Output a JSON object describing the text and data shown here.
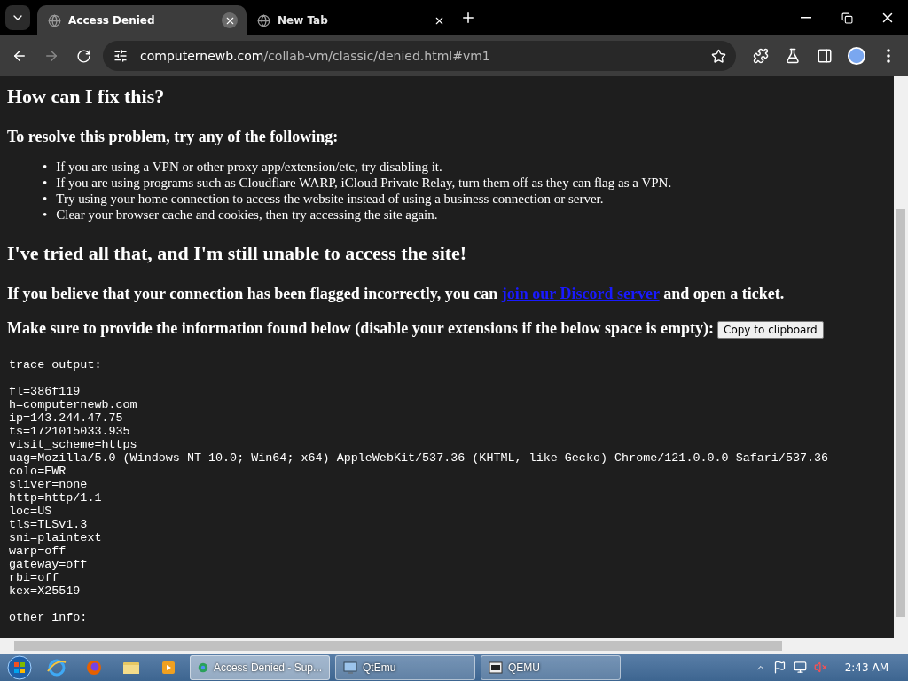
{
  "tabs": [
    {
      "title": "Access Denied",
      "selected": true
    },
    {
      "title": "New Tab",
      "selected": false
    }
  ],
  "address": {
    "domain": "computernewb.com",
    "path": "/collab-vm/classic/denied.html#vm1"
  },
  "page": {
    "heading": "How can I fix this?",
    "subheading": "To resolve this problem, try any of the following:",
    "tips": [
      {
        "bullet": "•",
        "text": "If you are using a VPN or other proxy app/extension/etc, try disabling it."
      },
      {
        "bullet": "•",
        "text": "If you are using programs such as Cloudflare WARP, iCloud Private Relay, turn them off as they can flag as a VPN."
      },
      {
        "bullet": "•",
        "text": "Try using your home connection to access the website instead of using a business connection or server."
      },
      {
        "bullet": "•",
        "text": "Clear your browser cache and cookies, then try accessing the site again."
      }
    ],
    "heading2": "I've tried all that, and I'm still unable to access the site!",
    "ticket": {
      "before": "If you believe that your connection has been flagged incorrectly, you can",
      "link": "join our Discord server",
      "after": "and open a ticket."
    },
    "info_prompt": "Make sure to provide the information found below (disable your extensions if the below space is empty):",
    "copy_button": "Copy to clipboard",
    "trace_title": "trace output:",
    "trace_lines": [
      "fl=386f119",
      "h=computernewb.com",
      "ip=143.244.47.75",
      "ts=1721015033.935",
      "visit_scheme=https",
      "uag=Mozilla/5.0 (Windows NT 10.0; Win64; x64) AppleWebKit/537.36 (KHTML, like Gecko) Chrome/121.0.0.0 Safari/537.36",
      "colo=EWR",
      "sliver=none",
      "http=http/1.1",
      "loc=US",
      "tls=TLSv1.3",
      "sni=plaintext",
      "warp=off",
      "gateway=off",
      "rbi=off",
      "kex=X25519"
    ],
    "other_info": "other info:"
  },
  "taskbar": {
    "pinned": [
      {
        "kind": "ie"
      },
      {
        "kind": "firefox"
      },
      {
        "kind": "folder"
      },
      {
        "kind": "media"
      }
    ],
    "tasks": [
      {
        "label": "Access Denied - Sup...",
        "kind": "browser",
        "selected": true
      },
      {
        "label": "QtEmu",
        "kind": "app",
        "selected": false
      },
      {
        "label": "QEMU",
        "kind": "console",
        "selected": false
      }
    ],
    "clock": "2:43 AM"
  }
}
